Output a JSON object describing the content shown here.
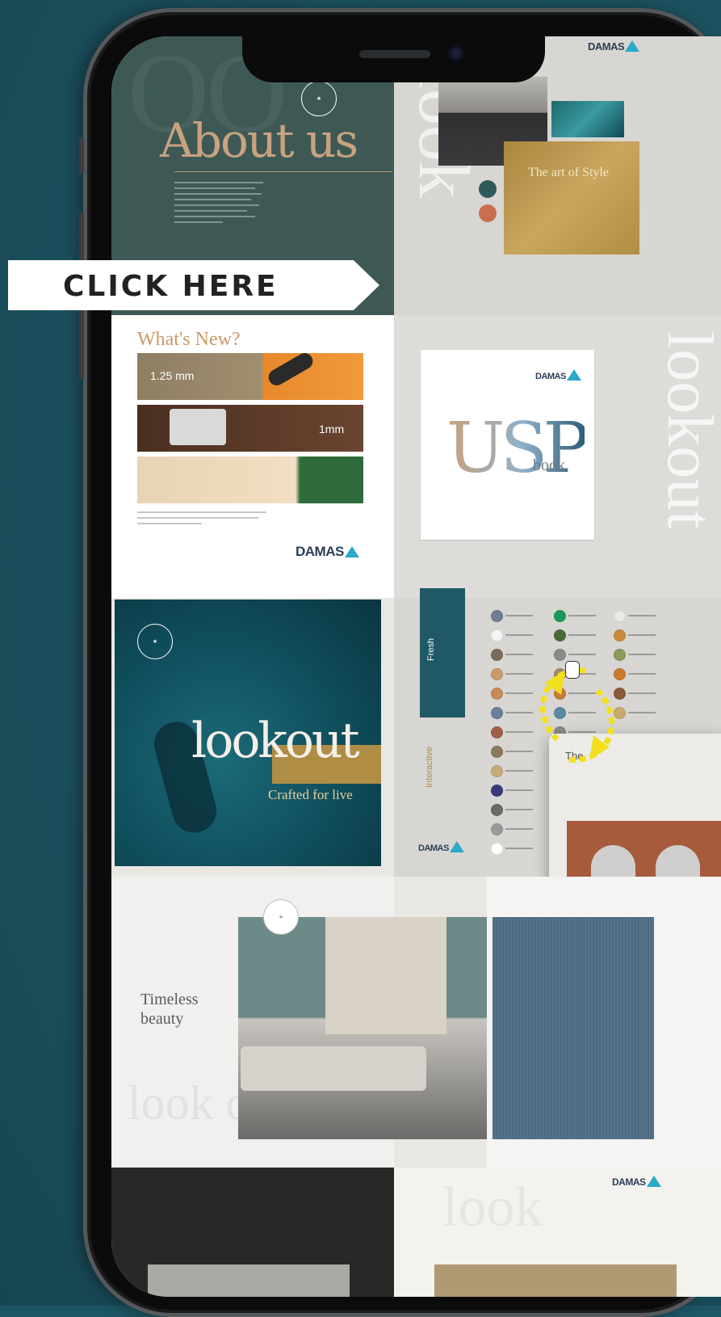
{
  "brand": {
    "logo_text": "DAMAS"
  },
  "cta": {
    "label": "CLICK HERE"
  },
  "about": {
    "title": "About us"
  },
  "style_card": {
    "title": "The art of Style"
  },
  "whats_new": {
    "title": "What's New?",
    "strip1": "1.25 mm",
    "strip2": "1mm"
  },
  "usp": {
    "big": "USP",
    "sub": "book"
  },
  "lookout": {
    "title": "lookout",
    "subtitle": "Crafted for live"
  },
  "fresh": {
    "word1": "Fresh",
    "word2": "Interactive"
  },
  "living": {
    "title_line1": "Timeless",
    "title_line2": "beauty",
    "watermark": "look out"
  },
  "popup": {
    "title": "The"
  },
  "colors": {
    "dots_col1": [
      "#6f7f8f",
      "#f5f5f5",
      "#7a6a5a",
      "#c99a6a",
      "#c98a5a",
      "#6a7f9a",
      "#a0604a",
      "#8a7a5a",
      "#c9a87a",
      "#3a3a7a",
      "#6a6a6a",
      "#9a9a9a",
      "#ffffff"
    ],
    "dots_col2": [
      "#1a9a5a",
      "#4a6a3a",
      "#8a8a8a",
      "#a08a6a",
      "#c97a3a",
      "#5a8aa0",
      "#8a8a8a"
    ],
    "dots_col3": [
      "#e8e8e8",
      "#c98a3a",
      "#8a9a5a",
      "#c97a2a",
      "#8a5a3a",
      "#c9aa6a"
    ]
  },
  "accent": {
    "teal": "#1f5966",
    "gold": "#b08d45",
    "arrow": "#f2e01f"
  }
}
